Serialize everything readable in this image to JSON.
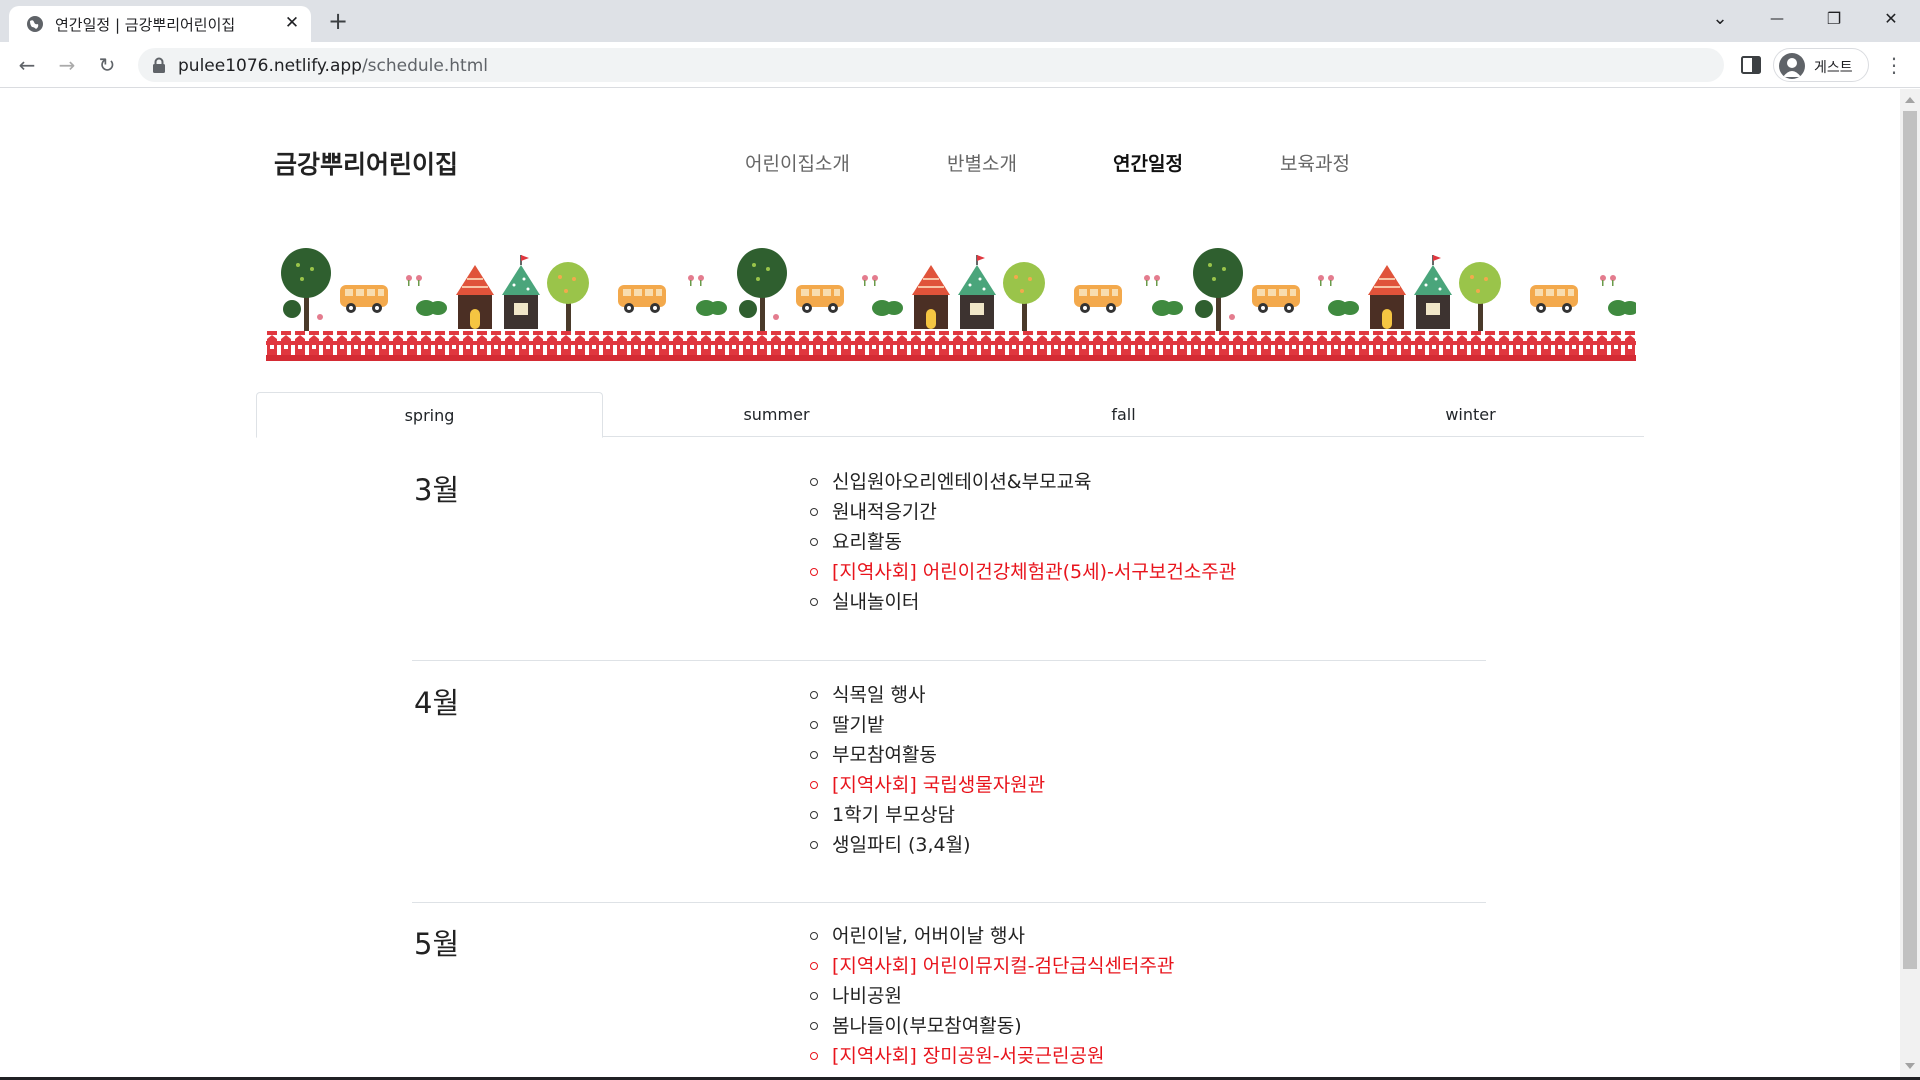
{
  "browser": {
    "tab_title": "연간일정 | 금강뿌리어린이집",
    "close_glyph": "✕",
    "new_tab_glyph": "+",
    "url_host": "pulee1076.netlify.app",
    "url_path": "/schedule.html",
    "profile_label": "게스트",
    "back_glyph": "←",
    "forward_glyph": "→",
    "reload_glyph": "↻",
    "menu_glyph": "⋮",
    "tab_search_glyph": "⌄",
    "minimize_glyph": "—",
    "restore_glyph": "❐",
    "window_close_glyph": "✕"
  },
  "site": {
    "logo": "금강뿌리어린이집",
    "nav": [
      {
        "label": "어린이집소개"
      },
      {
        "label": "반별소개"
      },
      {
        "label": "연간일정",
        "active": true
      },
      {
        "label": "보육과정"
      }
    ]
  },
  "seasons": {
    "tabs": [
      {
        "label": "spring",
        "active": true
      },
      {
        "label": "summer"
      },
      {
        "label": "fall"
      },
      {
        "label": "winter"
      }
    ]
  },
  "schedule": [
    {
      "month": "3월",
      "items": [
        {
          "text": "신입원아오리엔테이션&부모교육"
        },
        {
          "text": "원내적응기간"
        },
        {
          "text": "요리활동"
        },
        {
          "text": "[지역사회] 어린이건강체험관(5세)-서구보건소주관",
          "highlight": true
        },
        {
          "text": "실내놀이터"
        }
      ]
    },
    {
      "month": "4월",
      "items": [
        {
          "text": "식목일 행사"
        },
        {
          "text": "딸기밭"
        },
        {
          "text": "부모참여활동"
        },
        {
          "text": "[지역사회] 국립생물자원관",
          "highlight": true
        },
        {
          "text": "1학기 부모상담"
        },
        {
          "text": "생일파티 (3,4월)"
        }
      ]
    },
    {
      "month": "5월",
      "items": [
        {
          "text": "어린이날, 어버이날 행사"
        },
        {
          "text": "[지역사회] 어린이뮤지컬-검단급식센터주관",
          "highlight": true
        },
        {
          "text": "나비공원"
        },
        {
          "text": "봄나들이(부모참여활동)"
        },
        {
          "text": "[지역사회] 장미공원-서곶근린공원",
          "highlight": true
        }
      ]
    }
  ],
  "colors": {
    "highlight": "#e8141c",
    "fence": "#e0373f",
    "tree_dark": "#2f5f2f",
    "tree_light": "#9ac44a",
    "house_roof_red": "#e0533a",
    "house_roof_green": "#4aa57b",
    "bus": "#f3a94c"
  },
  "banner": {
    "icons": [
      "tree-icon",
      "bus-icon",
      "house-icon",
      "fence-icon",
      "flower-icon",
      "bush-icon"
    ]
  }
}
